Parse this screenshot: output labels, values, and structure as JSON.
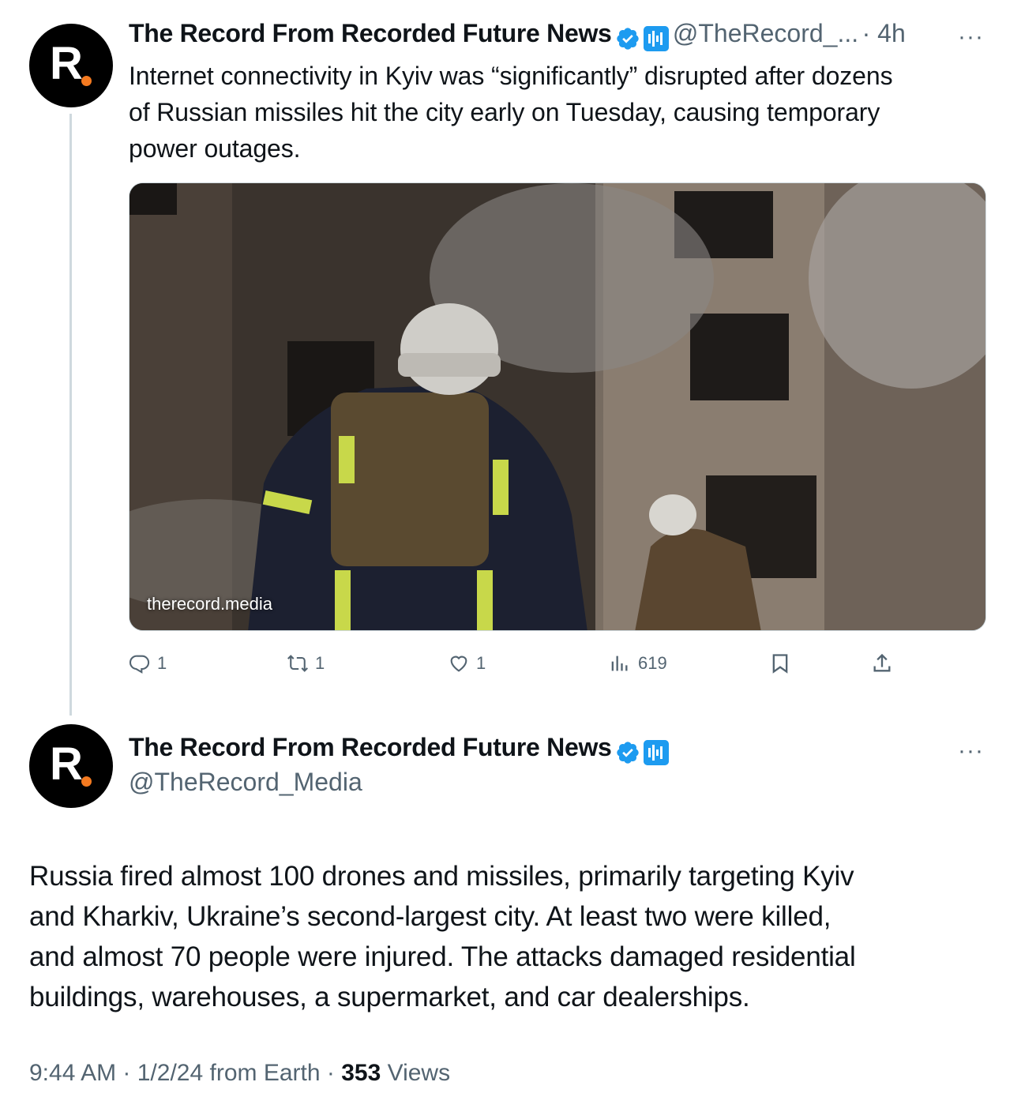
{
  "tweet1": {
    "author_name": "The Record From Recorded Future News",
    "handle": "@TheRecord_...",
    "time": "· 4h",
    "more": "···",
    "text": "Internet connectivity in Kyiv was “significantly” disrupted after dozens of Russian missiles hit the city early on Tuesday, causing temporary power outages.",
    "text_lines": [
      "Internet connectivity in Kyiv was “significantly” disrupted after dozens",
      "of Russian missiles hit the city early on Tuesday, causing temporary",
      "power outages."
    ],
    "media_link": "therecord.media",
    "counts": {
      "replies": "1",
      "reposts": "1",
      "likes": "1",
      "views": "619"
    }
  },
  "tweet2": {
    "author_name": "The Record From Recorded Future News",
    "handle": "@TheRecord_Media",
    "more": "···",
    "text_lines": [
      "Russia fired almost 100 drones and missiles, primarily targeting Kyiv",
      "and Kharkiv, Ukraine’s second-largest city. At least two were killed,",
      "and almost 70 people were injured. The attacks damaged residential",
      "buildings, warehouses, a supermarket, and car dealerships."
    ],
    "footer_time": "9:44 AM",
    "footer_date": "· 1/2/24 from Earth ·",
    "views_count": "353",
    "views_label": "Views"
  },
  "avatar_letter": "R",
  "colors": {
    "accent": "#1d9bf0",
    "brand_dot": "#f47a20",
    "muted": "#536471",
    "text": "#0f1419"
  },
  "icons": [
    "reply-icon",
    "repost-icon",
    "like-icon",
    "views-icon",
    "bookmark-icon",
    "share-icon",
    "verified-icon",
    "affiliate-icon",
    "more-icon"
  ]
}
